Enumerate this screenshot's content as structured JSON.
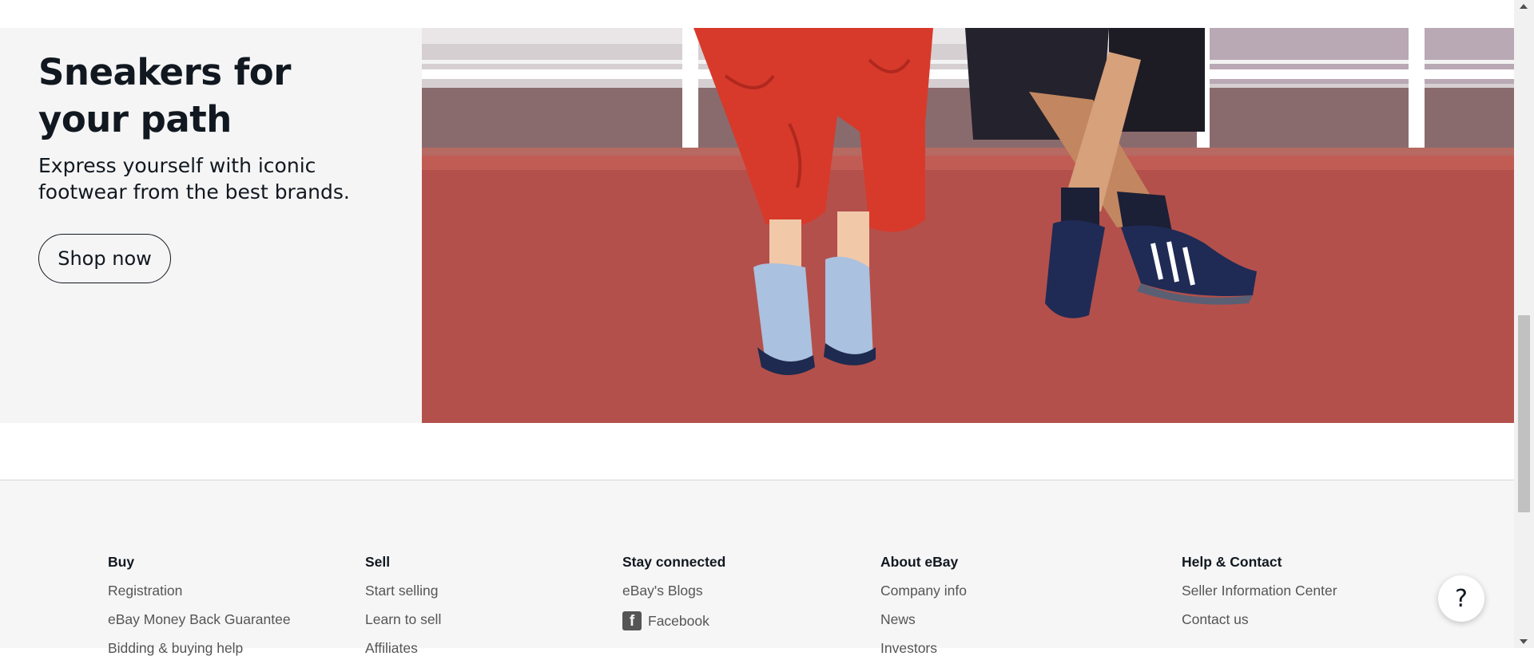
{
  "hero": {
    "title": "Sneakers for your path",
    "subtitle": "Express yourself with iconic footwear from the best brands.",
    "cta_label": "Shop now"
  },
  "footer": {
    "columns": [
      {
        "heading": "Buy",
        "links": [
          "Registration",
          "eBay Money Back Guarantee",
          "Bidding & buying help"
        ]
      },
      {
        "heading": "Sell",
        "links": [
          "Start selling",
          "Learn to sell",
          "Affiliates"
        ]
      },
      {
        "heading": "Stay connected",
        "links": [
          "eBay's Blogs",
          "Facebook"
        ]
      },
      {
        "heading": "About eBay",
        "links": [
          "Company info",
          "News",
          "Investors"
        ]
      },
      {
        "heading": "Help & Contact",
        "links": [
          "Seller Information Center",
          "Contact us"
        ]
      }
    ]
  },
  "help_button": {
    "label": "?"
  },
  "icons": {
    "facebook": "facebook-icon",
    "help": "question-icon"
  },
  "colors": {
    "text": "#111820",
    "link": "#555555",
    "hero_bg": "#f5f5f5",
    "footer_bg": "#f6f6f6"
  }
}
